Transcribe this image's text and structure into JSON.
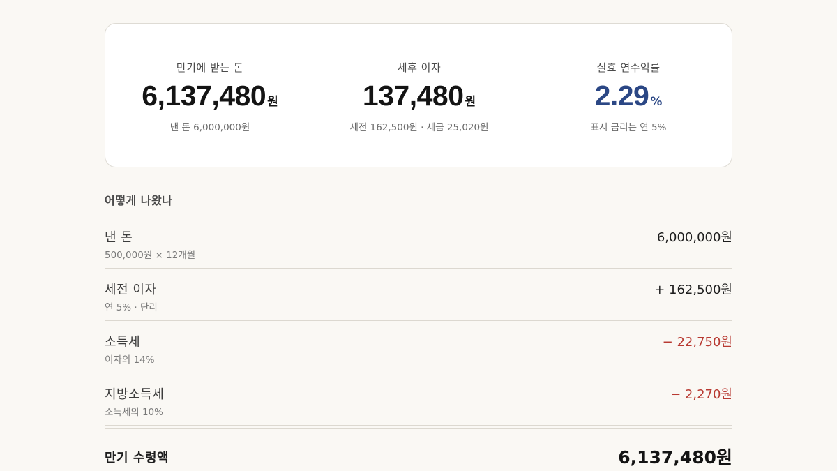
{
  "summary": {
    "maturity": {
      "label": "만기에 받는 돈",
      "value": "6,137,480",
      "unit": "원",
      "sub": "낸 돈 6,000,000원"
    },
    "after_tax_interest": {
      "label": "세후 이자",
      "value": "137,480",
      "unit": "원",
      "sub": "세전 162,500원 · 세금 25,020원"
    },
    "effective_rate": {
      "label": "실효 연수익률",
      "value": "2.29",
      "unit": "%",
      "sub": "표시 금리는 연 5%"
    }
  },
  "breakdown": {
    "title": "어떻게 나왔나",
    "rows": [
      {
        "label": "낸 돈",
        "sub": "500,000원 × 12개월",
        "amount": "6,000,000원",
        "sign": "positive"
      },
      {
        "label": "세전 이자",
        "sub": "연 5% · 단리",
        "amount": "+ 162,500원",
        "sign": "positive"
      },
      {
        "label": "소득세",
        "sub": "이자의 14%",
        "amount": "− 22,750원",
        "sign": "negative"
      },
      {
        "label": "지방소득세",
        "sub": "소득세의 10%",
        "amount": "− 2,270원",
        "sign": "negative"
      }
    ],
    "total": {
      "label": "만기 수령액",
      "amount": "6,137,480원"
    }
  },
  "colors": {
    "background": "#faf8f4",
    "accent_rate": "#2b4785",
    "negative": "#b83a32"
  }
}
